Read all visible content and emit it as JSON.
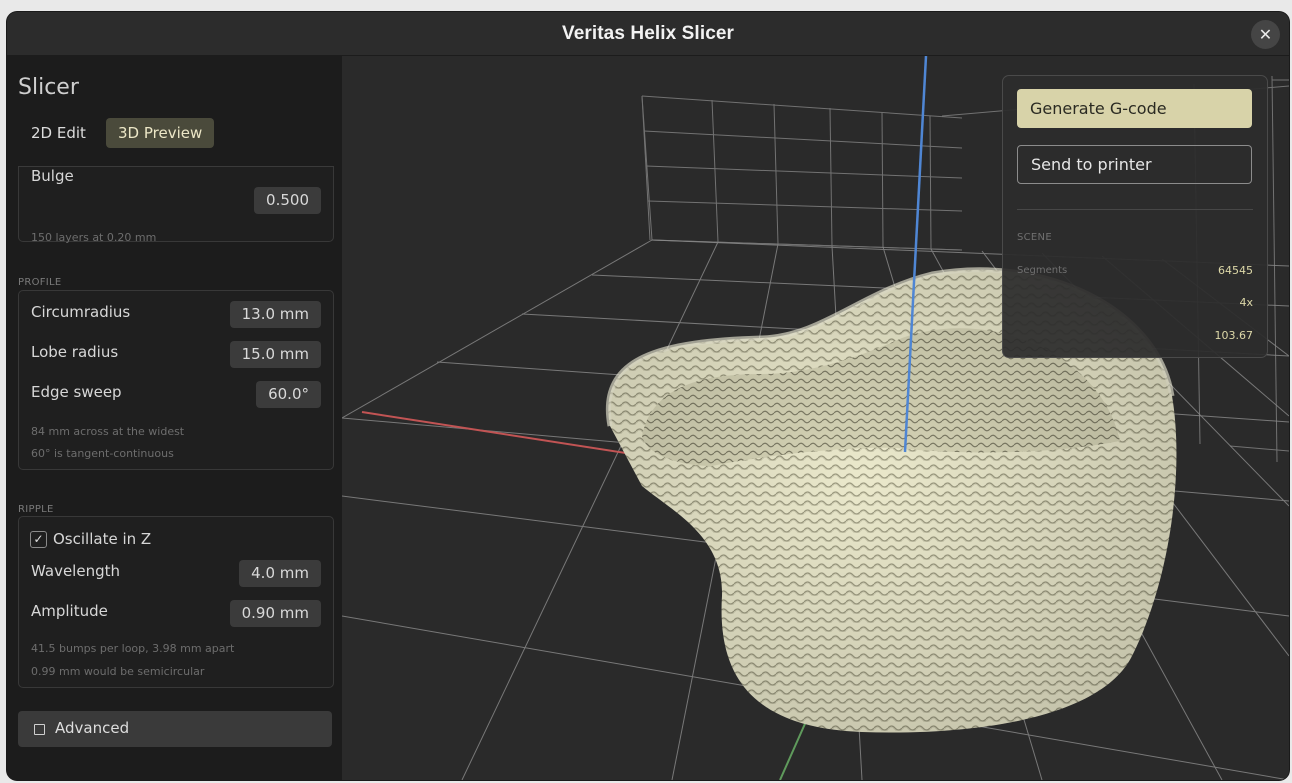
{
  "window": {
    "title": "Veritas Helix Slicer",
    "close_label": "✕"
  },
  "sidebar": {
    "title": "Slicer",
    "tabs": [
      {
        "label": "2D Edit"
      },
      {
        "label": "3D Preview"
      }
    ],
    "top_group": {
      "bulge_label": "Bulge",
      "bulge_value": "0.500",
      "hint": "150 layers at 0.20 mm"
    },
    "profile": {
      "section": "PROFILE",
      "circumradius_label": "Circumradius",
      "circumradius_value": "13.0 mm",
      "lobe_label": "Lobe radius",
      "lobe_value": "15.0 mm",
      "sweep_label": "Edge sweep",
      "sweep_value": "60.0°",
      "hint1": "84 mm across at the widest",
      "hint2": "60° is tangent-continuous"
    },
    "ripple": {
      "section": "RIPPLE",
      "oscillate_label": "Oscillate in Z",
      "oscillate_checked": true,
      "check_glyph": "✓",
      "wavelength_label": "Wavelength",
      "wavelength_value": "4.0 mm",
      "amplitude_label": "Amplitude",
      "amplitude_value": "0.90 mm",
      "hint1": "41.5 bumps per loop, 3.98 mm apart",
      "hint2": "0.99 mm would be semicircular"
    },
    "advanced_label": "Advanced"
  },
  "panel": {
    "generate_label": "Generate G-code",
    "send_label": "Send to printer",
    "scene_label": "SCENE",
    "stats": [
      {
        "key": "Segments",
        "value": "64545"
      },
      {
        "key": "",
        "value": "4x"
      },
      {
        "key": "",
        "value": "103.67"
      }
    ]
  },
  "colors": {
    "accent": "#d8d3a9",
    "model": "#ebe9cc",
    "axis_x": "#c25454",
    "axis_y": "#5f9a5c",
    "axis_z": "#4f86d4"
  }
}
